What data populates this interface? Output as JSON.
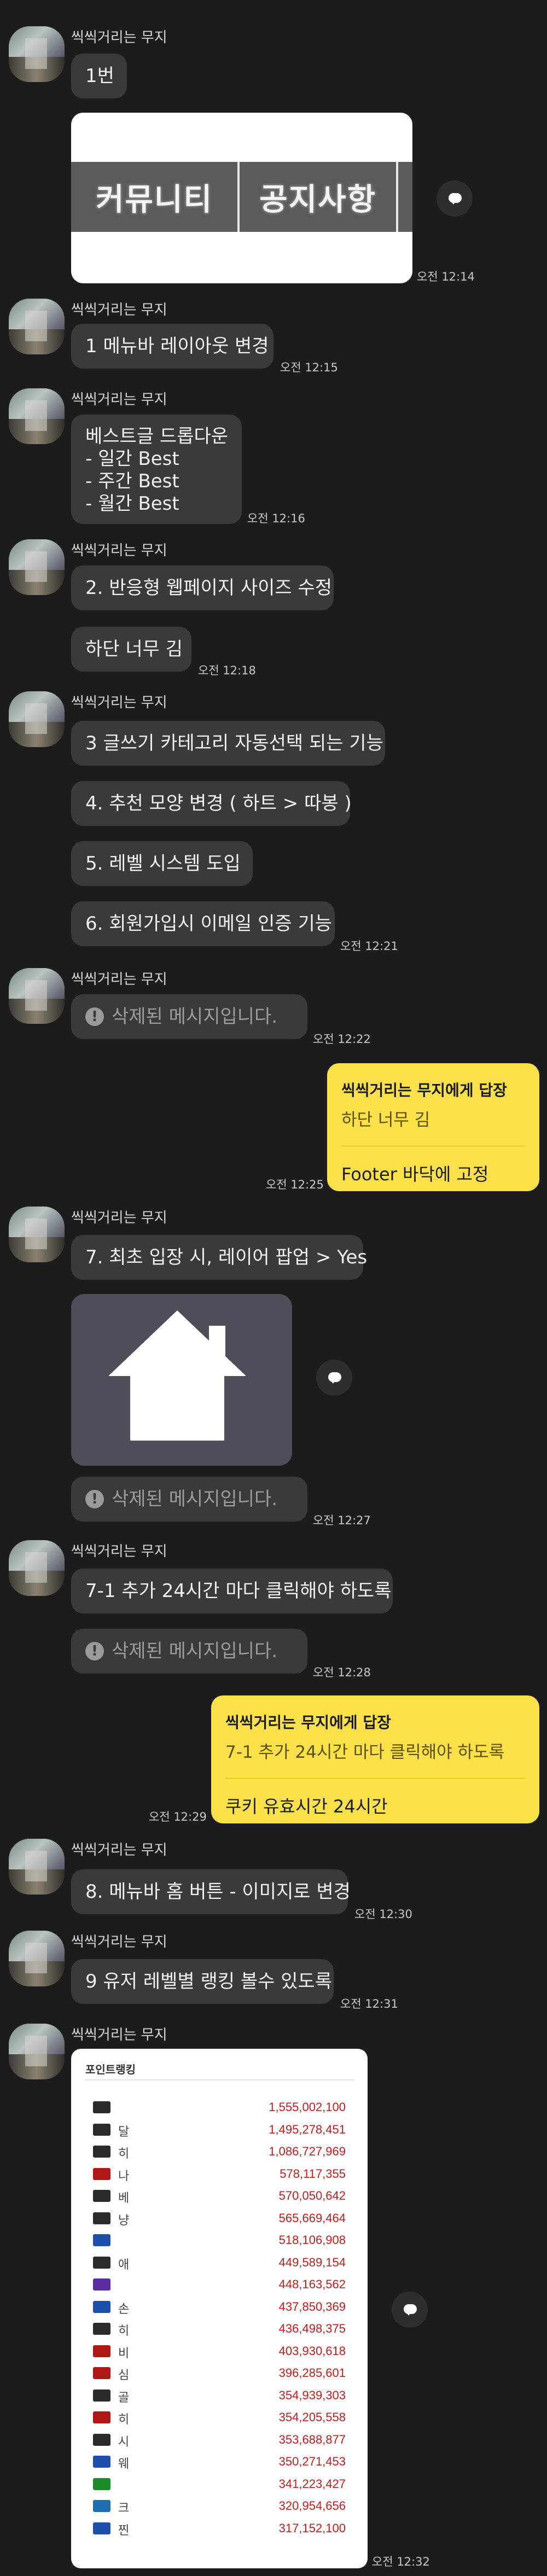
{
  "sender_name": "씩씩거리는 무지",
  "messages": {
    "m1_text": "1번",
    "m1_image_menu": [
      "커뮤니티",
      "공지사항"
    ],
    "m1_time": "오전 12:14",
    "m2_text": "1 메뉴바 레이아웃 변경",
    "m2_time": "오전 12:15",
    "m3_lines": [
      "베스트글 드롭다운",
      "- 일간 Best",
      "- 주간 Best",
      "- 월간 Best"
    ],
    "m3_time": "오전 12:16",
    "m4_text": "2. 반응형 웹페이지 사이즈 수정",
    "m4b_text": "하단 너무 김",
    "m4_time": "오전 12:18",
    "m5_text": "3 글쓰기 카테고리 자동선택 되는 기능",
    "m6_text": "4. 추천 모양 변경 ( 하트 > 따봉 )",
    "m7_text": "5. 레벨 시스템 도입",
    "m8_text": "6. 회원가입시 이메일 인증 기능",
    "m8_time": "오전 12:21",
    "deleted_text": "삭제된 메시지입니다.",
    "m9_time": "오전 12:22",
    "r1_head": "씩씩거리는 무지에게 답장",
    "r1_quote": "하단 너무 김",
    "r1_text": "Footer 바닥에 고정",
    "r1_time": "오전 12:25",
    "m10_text": "7. 최초 입장 시, 레이어 팝업 > Yes",
    "m11_time": "오전 12:27",
    "m12_text": "7-1 추가 24시간 마다 클릭해야 하도록",
    "m13_time": "오전 12:28",
    "r2_head": "씩씩거리는 무지에게 답장",
    "r2_quote": "7-1 추가 24시간 마다 클릭해야 하도록",
    "r2_text": "쿠키 유효시간 24시간",
    "r2_time": "오전 12:29",
    "m14_text": "8. 메뉴바 홈 버튼 - 이미지로 변경",
    "m14_time": "오전 12:30",
    "m15_text": "9 유저 레벨별 랭킹 볼수 있도록",
    "m15_time": "오전 12:31",
    "m16_time": "오전 12:32"
  },
  "ranking": {
    "title": "포인트랭킹",
    "rows": [
      {
        "name": "",
        "points": "1,555,002,100",
        "badge": "#2b2b2b"
      },
      {
        "name": "달",
        "points": "1,495,278,451",
        "badge": "#2b2b2b"
      },
      {
        "name": "히",
        "points": "1,086,727,969",
        "badge": "#2b2b2b"
      },
      {
        "name": "나",
        "points": "578,117,355",
        "badge": "#b01818"
      },
      {
        "name": "베",
        "points": "570,050,642",
        "badge": "#2b2b2b"
      },
      {
        "name": "냥",
        "points": "565,669,464",
        "badge": "#2b2b2b"
      },
      {
        "name": "",
        "points": "518,106,908",
        "badge": "#1f4fa8"
      },
      {
        "name": "애",
        "points": "449,589,154",
        "badge": "#2b2b2b"
      },
      {
        "name": "",
        "points": "448,163,562",
        "badge": "#5a2ea0"
      },
      {
        "name": "손",
        "points": "437,850,369",
        "badge": "#1f4fa8"
      },
      {
        "name": "히",
        "points": "436,498,375",
        "badge": "#2b2b2b"
      },
      {
        "name": "비",
        "points": "403,930,618",
        "badge": "#b01818"
      },
      {
        "name": "심",
        "points": "396,285,601",
        "badge": "#b01818"
      },
      {
        "name": "골",
        "points": "354,939,303",
        "badge": "#2b2b2b"
      },
      {
        "name": "히",
        "points": "354,205,558",
        "badge": "#b01818"
      },
      {
        "name": "시",
        "points": "353,688,877",
        "badge": "#2b2b2b"
      },
      {
        "name": "웨",
        "points": "350,271,453",
        "badge": "#1f4fa8"
      },
      {
        "name": "",
        "points": "341,223,427",
        "badge": "#1e8a2a"
      },
      {
        "name": "크",
        "points": "320,954,656",
        "badge": "#1f6fb0"
      },
      {
        "name": "찐",
        "points": "317,152,100",
        "badge": "#1f4fa8"
      }
    ]
  }
}
